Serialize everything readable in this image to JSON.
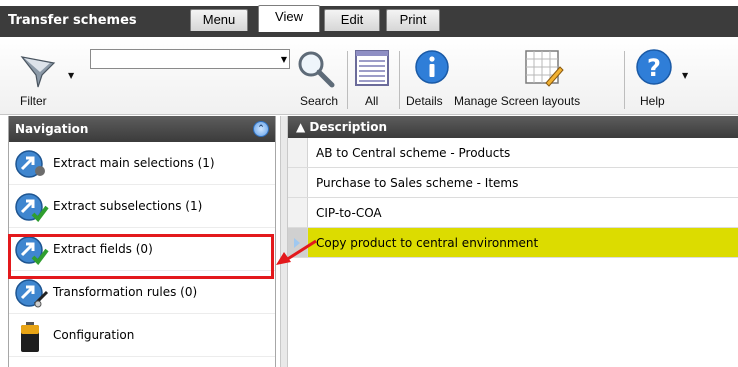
{
  "app": {
    "title": "Transfer schemes"
  },
  "tabs": [
    {
      "label": "Menu",
      "active": false
    },
    {
      "label": "View",
      "active": true
    },
    {
      "label": "Edit",
      "active": false
    },
    {
      "label": "Print",
      "active": false
    }
  ],
  "toolbar": {
    "filter_label": "Filter",
    "search_value": "",
    "search_label": "Search",
    "all_label": "All",
    "details_label": "Details",
    "manage_layouts_label": "Manage Screen layouts",
    "help_label": "Help"
  },
  "navigation": {
    "title": "Navigation",
    "items": [
      {
        "label": "Extract main selections (1)",
        "icon": "extract-arrow-icon"
      },
      {
        "label": "Extract subselections (1)",
        "icon": "extract-check-icon"
      },
      {
        "label": "Extract fields (0)",
        "icon": "extract-check-icon",
        "highlighted": true
      },
      {
        "label": "Transformation rules (0)",
        "icon": "transform-icon"
      },
      {
        "label": "Configuration",
        "icon": "battery-icon"
      }
    ]
  },
  "grid": {
    "column": "Description",
    "rows": [
      "AB to Central scheme - Products",
      "Purchase to Sales scheme - Items",
      "CIP-to-COA",
      "Copy product to central environment"
    ],
    "selected_row": 3
  },
  "colors": {
    "dark_bar": "#3c3c3c",
    "selection": "#dcdc00",
    "annotation": "#e3191c"
  }
}
